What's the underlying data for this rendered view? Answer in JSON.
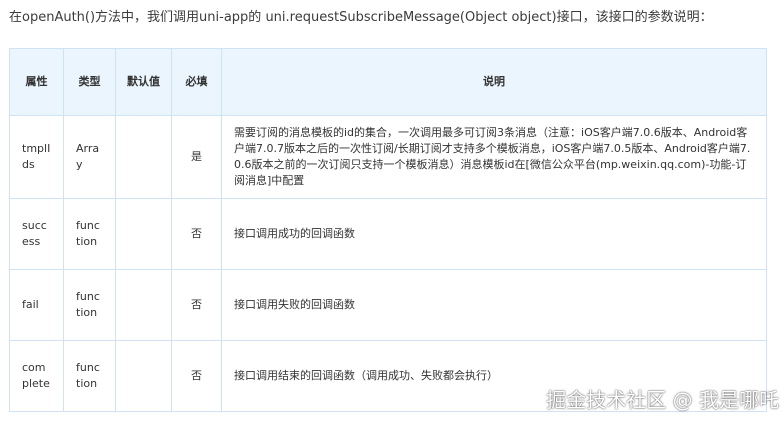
{
  "intro_text": "在openAuth()方法中，我们调用uni-app的 uni.requestSubscribeMessage(Object object)接口，该接口的参数说明：",
  "table": {
    "headers": [
      "属性",
      "类型",
      "默认值",
      "必填",
      "说明"
    ],
    "rows": [
      {
        "property": "tmplIds",
        "type": "Array",
        "default": "",
        "required": "是",
        "description": "需要订阅的消息模板的id的集合，一次调用最多可订阅3条消息（注意：iOS客户端7.0.6版本、Android客户端7.0.7版本之后的一次性订阅/长期订阅才支持多个模板消息，iOS客户端7.0.5版本、Android客户端7.0.6版本之前的一次订阅只支持一个模板消息）消息模板id在[微信公众平台(mp.weixin.qq.com)-功能-订阅消息]中配置"
      },
      {
        "property": "success",
        "type": "function",
        "default": "",
        "required": "否",
        "description": "接口调用成功的回调函数"
      },
      {
        "property": "fail",
        "type": "function",
        "default": "",
        "required": "否",
        "description": "接口调用失败的回调函数"
      },
      {
        "property": "complete",
        "type": "function",
        "default": "",
        "required": "否",
        "description": "接口调用结束的回调函数（调用成功、失败都会执行）"
      }
    ]
  },
  "watermark": "掘金技术社区 @ 我是哪吒",
  "colors": {
    "header_bg": "#eaf5fd",
    "border": "#cfe3f4"
  }
}
